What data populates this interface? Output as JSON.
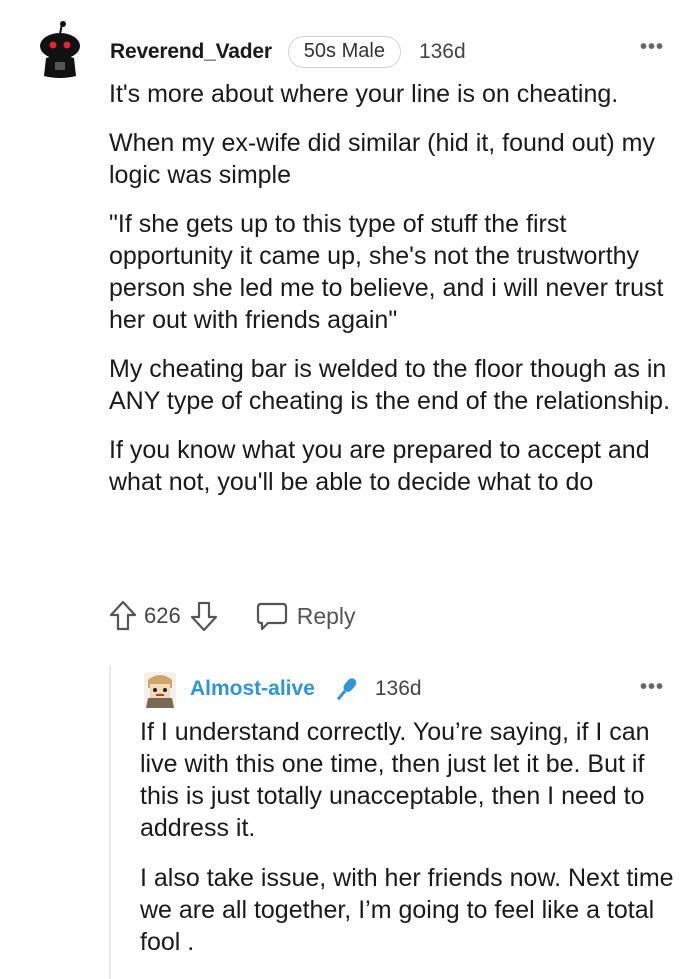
{
  "comment": {
    "username": "Reverend_Vader",
    "flair": "50s Male",
    "age": "136d",
    "more": "•••",
    "paragraphs": [
      "It's more about where your line is on cheating.",
      "When my ex-wife did similar (hid it, found out) my logic was simple",
      "\"If she gets up to this type of stuff the first opportunity it came up, she's not the trustworthy person she led me to believe, and i will never trust her out with friends again\"",
      "My cheating bar is welded to the floor though as in ANY type of cheating is the end of the relationship.",
      "If you know what you are prepared to accept and what not, you'll be able to decide what to do"
    ],
    "score": "626",
    "reply_label": "Reply",
    "icons": {
      "avatar": "snoo-avatar-icon",
      "upvote": "upvote-icon",
      "downvote": "downvote-icon",
      "reply": "reply-bubble-icon"
    }
  },
  "reply": {
    "username": "Almost-alive",
    "age": "136d",
    "more": "•••",
    "paragraphs": [
      "If I understand correctly. You’re saying, if I can live with this one time, then just let it be. But if this is just totally unacceptable, then I need to address it.",
      "I also take issue, with her friends now. Next time we are all together, I’m going to feel like a total fool ."
    ],
    "icons": {
      "avatar": "cartoon-avatar-icon",
      "badge": "microphone-icon"
    },
    "accent_color": "#2d97d6"
  }
}
